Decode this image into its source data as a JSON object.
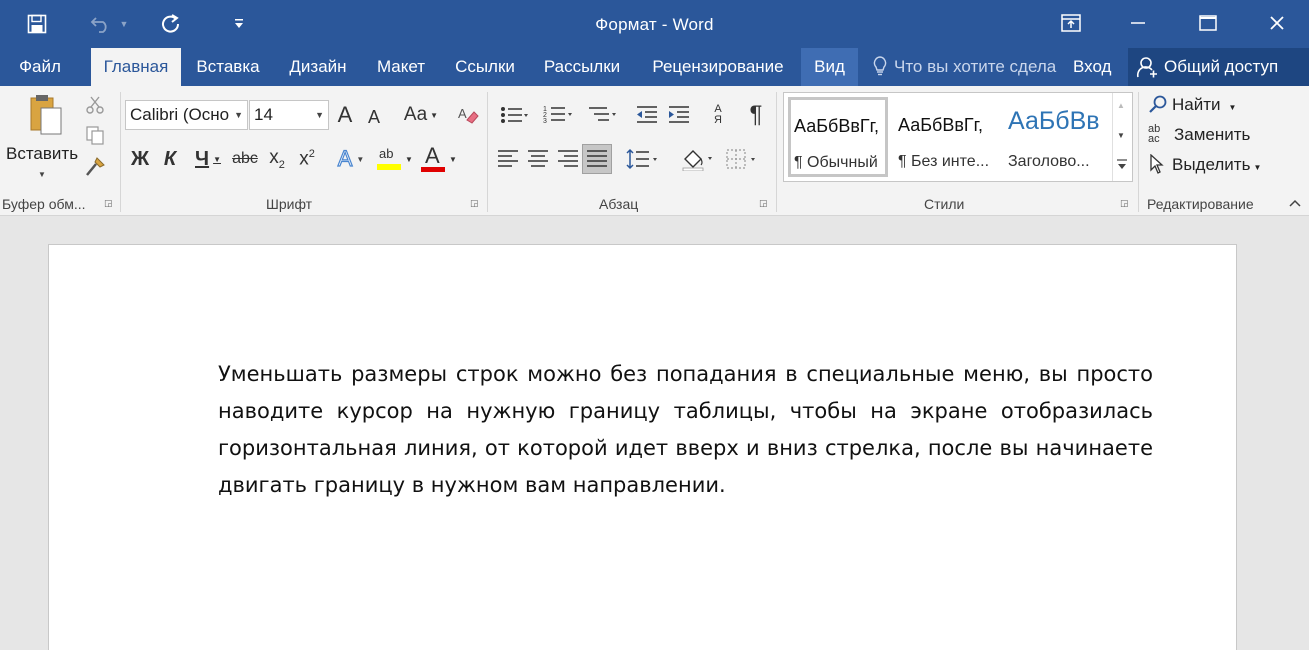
{
  "window": {
    "title": "Формат - Word",
    "colors": {
      "brand": "#2b579a",
      "ribbon_bg": "#f3f3f3",
      "canvas_bg": "#e6e6e6"
    }
  },
  "quick_access": [
    {
      "icon": "save-icon"
    },
    {
      "icon": "undo-icon"
    },
    {
      "icon": "repeat-icon"
    },
    {
      "icon": "customize-qat-icon"
    }
  ],
  "window_controls": [
    {
      "icon": "ribbon-display-options-icon"
    },
    {
      "icon": "minimize-icon"
    },
    {
      "icon": "maximize-icon"
    },
    {
      "icon": "close-icon"
    }
  ],
  "tabs": [
    {
      "label": "Файл"
    },
    {
      "label": "Главная"
    },
    {
      "label": "Вставка"
    },
    {
      "label": "Дизайн"
    },
    {
      "label": "Макет"
    },
    {
      "label": "Ссылки"
    },
    {
      "label": "Рассылки"
    },
    {
      "label": "Рецензирование"
    },
    {
      "label": "Вид"
    }
  ],
  "active_tab": "Главная",
  "tell_me": {
    "text": "Что вы хотите сдела"
  },
  "sign_in": {
    "label": "Вход"
  },
  "share": {
    "label": "Общий доступ"
  },
  "ribbon": {
    "clipboard": {
      "label": "Буфер обм...",
      "paste_label": "Вставить"
    },
    "font": {
      "label": "Шрифт",
      "font_name": "Calibri (Осно",
      "font_size": "14",
      "change_case_label": "Aa",
      "bold_label": "Ж",
      "italic_label": "К",
      "underline_label": "Ч",
      "strike_label": "abc",
      "subscript_label": "x",
      "subscript_mark": "2",
      "superscript_label": "x",
      "superscript_mark": "2",
      "effects_label": "A",
      "highlight_label": "ab",
      "font_color_label": "A",
      "grow_label": "A",
      "shrink_label": "A",
      "highlight_color": "#ffff00",
      "font_color": "#e00000"
    },
    "paragraph": {
      "label": "Абзац",
      "sort_label": "А Я",
      "pilcrow": "¶"
    },
    "styles": {
      "label": "Стили",
      "items": [
        {
          "preview": "АаБбВвГг,",
          "name": "¶ Обычный"
        },
        {
          "preview": "АаБбВвГг,",
          "name": "¶ Без инте..."
        },
        {
          "preview": "АаБбВв",
          "name": "Заголово..."
        }
      ]
    },
    "editing": {
      "label": "Редактирование",
      "find_label": "Найти",
      "replace_label": "Заменить",
      "replace_icon_text": "ab\nac",
      "select_label": "Выделить"
    }
  },
  "document": {
    "text": "Уменьшать размеры строк можно без попадания в специальные меню, вы просто наводите курсор на нужную границу таблицы, чтобы на экране отобразилась горизонтальная линия, от которой идет вверх и вниз стрелка, после вы начинаете двигать границу в нужном вам направлении."
  }
}
